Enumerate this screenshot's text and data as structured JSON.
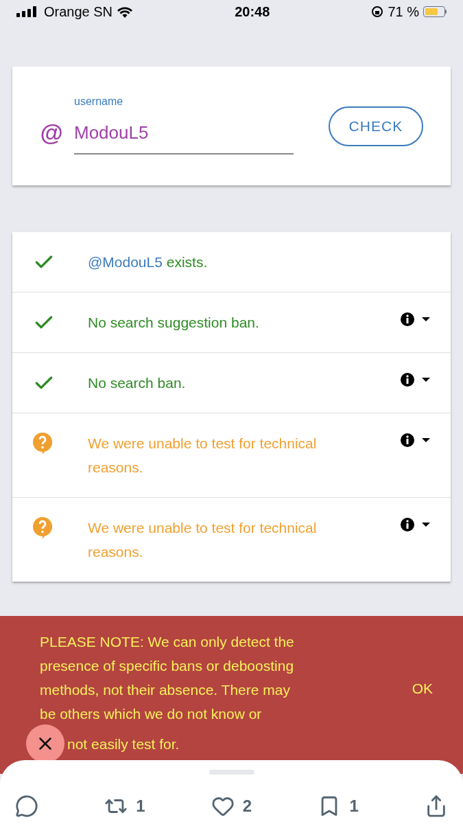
{
  "status_bar": {
    "carrier": "Orange SN",
    "time": "20:48",
    "battery": "71 %"
  },
  "search": {
    "label": "username",
    "prefix": "@",
    "value": "ModouL5",
    "button": "CHECK"
  },
  "results": [
    {
      "kind": "ok",
      "handle": "@ModouL5",
      "text": " exists.",
      "info": false
    },
    {
      "kind": "ok",
      "text": "No search suggestion ban.",
      "info": true
    },
    {
      "kind": "ok",
      "text": "No search ban.",
      "info": true
    },
    {
      "kind": "unknown",
      "text": "We were unable to test for technical reasons.",
      "info": true
    },
    {
      "kind": "unknown",
      "text": "We were unable to test for technical reasons.",
      "info": true
    }
  ],
  "notice": {
    "lines": [
      "PLEASE NOTE: We can only detect the",
      "presence of specific bans or deboosting",
      "methods, not their absence. There may",
      "be others which we do not know or",
      "not easily test for."
    ],
    "ok": "OK"
  },
  "actions": [
    {
      "kind": "reply"
    },
    {
      "kind": "retweet",
      "count": "1"
    },
    {
      "kind": "like",
      "count": "2"
    },
    {
      "kind": "bookmark",
      "count": "1"
    },
    {
      "kind": "share"
    }
  ]
}
